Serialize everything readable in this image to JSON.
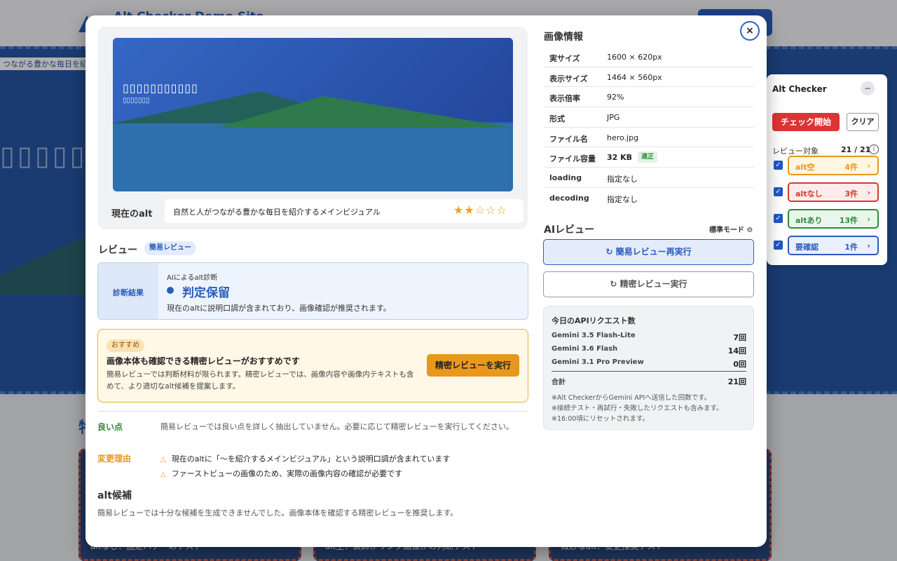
{
  "background": {
    "site_title": "Alt Checker Demo Site",
    "hero_tag": "つながる豊かな毎日を紹介",
    "hero_text": "▯▯▯▯▯▯▯▯▯",
    "section_title": "特",
    "cards": [
      "altなし：固定バナーのテスト",
      "alt空：装飾かリンク画像かの判断テスト",
      "微妙なalt：変更推奨テスト"
    ]
  },
  "alt_checker": {
    "title": "Alt Checker",
    "minimize": "−",
    "start_button": "チェック開始",
    "clear_button": "クリア",
    "target_label": "レビュー対象",
    "target_count": "21 / 21",
    "info_icon": "i",
    "filters": [
      {
        "label": "alt空",
        "count": "4件",
        "color": "#e8981c",
        "bg": "#fff6e3"
      },
      {
        "label": "altなし",
        "count": "3件",
        "color": "#d33a2c",
        "bg": "#fdeceb"
      },
      {
        "label": "altあり",
        "count": "13件",
        "color": "#2e8a3a",
        "bg": "#eaf6ec"
      },
      {
        "label": "要確認",
        "count": "1件",
        "color": "#2b5cbe",
        "bg": "#eaf0fc"
      }
    ],
    "check_mark": "✓",
    "arrow": "›"
  },
  "modal": {
    "close": "×",
    "preview": {
      "title_placeholder": "▯▯▯▯▯▯▯▯▯▯▯",
      "subtitle_placeholder": "▯▯▯▯▯▯▯"
    },
    "current_alt_label": "現在のalt",
    "current_alt_text": "自然と人がつながる豊かな毎日を紹介するメインビジュアル",
    "rating_stars": "★★☆☆☆",
    "rating": 2,
    "rating_max": 5,
    "review": {
      "title": "レビュー",
      "mode_pill": "簡易レビュー",
      "diagnosis_label": "診断結果",
      "diagnosis_sub": "AIによるalt診断",
      "verdict": "判定保留",
      "verdict_desc": "現在のaltに説明口調が含まれており、画像確認が推奨されます。"
    },
    "recommend": {
      "badge": "おすすめ",
      "title": "画像本体も確認できる精密レビューがおすすめです",
      "desc": "簡易レビューでは判断材料が限られます。精密レビューでは、画像内容や画像内テキストも含めて、より適切なalt候補を提案します。",
      "button": "精密レビューを実行"
    },
    "good_points": {
      "label": "良い点",
      "text": "簡易レビューでは良い点を詳しく抽出していません。必要に応じて精密レビューを実行してください。"
    },
    "change_reasons": {
      "label": "変更理由",
      "icon": "△",
      "items": [
        "現在のaltに「〜を紹介するメインビジュアル」という説明口調が含まれています",
        "ファーストビューの画像のため、実際の画像内容の確認が必要です"
      ]
    },
    "alt_candidates": {
      "title": "alt候補",
      "text": "簡易レビューでは十分な候補を生成できませんでした。画像本体を確認する精密レビューを推奨します。"
    },
    "image_info": {
      "title": "画像情報",
      "rows": [
        {
          "key": "実サイズ",
          "value": "1600 × 620px"
        },
        {
          "key": "表示サイズ",
          "value": "1464 × 560px"
        },
        {
          "key": "表示倍率",
          "value": "92%"
        },
        {
          "key": "形式",
          "value": "JPG"
        },
        {
          "key": "ファイル名",
          "value": "hero.jpg"
        },
        {
          "key": "ファイル容量",
          "value": "32 KB",
          "badge": "適正"
        },
        {
          "key": "loading",
          "value": "指定なし"
        },
        {
          "key": "decoding",
          "value": "指定なし"
        }
      ]
    },
    "ai_review": {
      "title": "AIレビュー",
      "mode": "標準モード ⚙",
      "quick_button": "↻ 簡易レビュー再実行",
      "precise_button": "↻ 精密レビュー実行"
    },
    "api_usage": {
      "title": "今日のAPIリクエスト数",
      "rows": [
        {
          "model": "Gemini 3.5 Flash-Lite",
          "count": "7回"
        },
        {
          "model": "Gemini 3.6 Flash",
          "count": "14回"
        },
        {
          "model": "Gemini 3.1 Pro Preview",
          "count": "0回"
        }
      ],
      "total_label": "合計",
      "total": "21回",
      "notes": [
        "※Alt CheckerからGemini APIへ送信した回数です。",
        "※接続テスト・再試行・失敗したリクエストも含みます。",
        "※16:00頃にリセットされます。"
      ]
    }
  }
}
